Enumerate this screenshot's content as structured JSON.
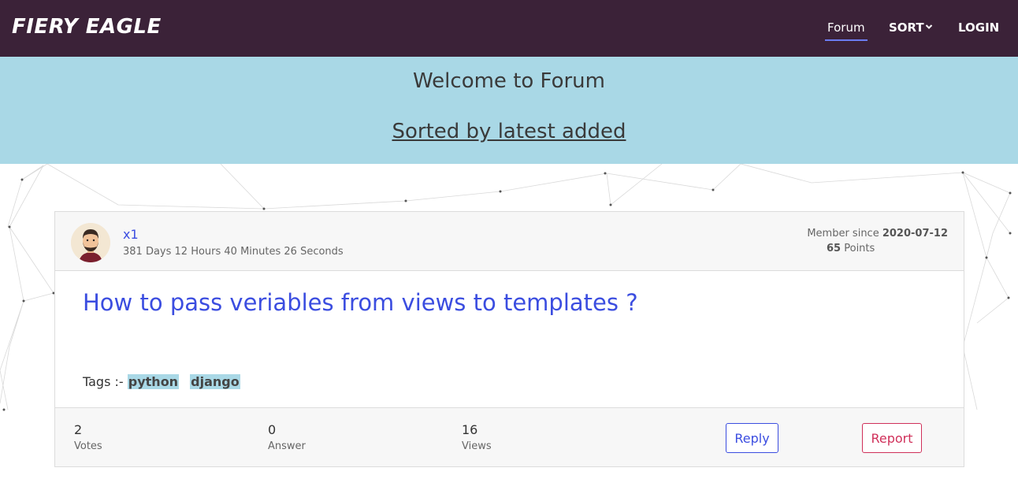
{
  "navbar": {
    "brand": "FIERY EAGLE",
    "links": {
      "forum": "Forum",
      "sort": "SORT",
      "login": "LOGIN"
    },
    "sort_icon": "chevron-down-icon",
    "active": "Forum",
    "bg_color": "#3b2238"
  },
  "banner": {
    "title": "Welcome to Forum",
    "subtitle": "Sorted by latest added",
    "bg_color": "#a9d8e6"
  },
  "post": {
    "username": "x1",
    "elapsed": "381 Days 12 Hours 40 Minutes 26 Seconds",
    "member_since_label": "Member since",
    "member_since_date": "2020-07-12",
    "points_value": "65",
    "points_label": "Points",
    "title": "How to pass veriables from views to templates ?",
    "tags_label": "Tags :-",
    "tags": [
      "python",
      "django"
    ],
    "stats": {
      "votes_value": "2",
      "votes_label": "Votes",
      "answer_value": "0",
      "answer_label": "Answer",
      "views_value": "16",
      "views_label": "Views"
    },
    "reply_label": "Reply",
    "report_label": "Report",
    "accent_color": "#3b4de0",
    "report_color": "#d0305a"
  }
}
